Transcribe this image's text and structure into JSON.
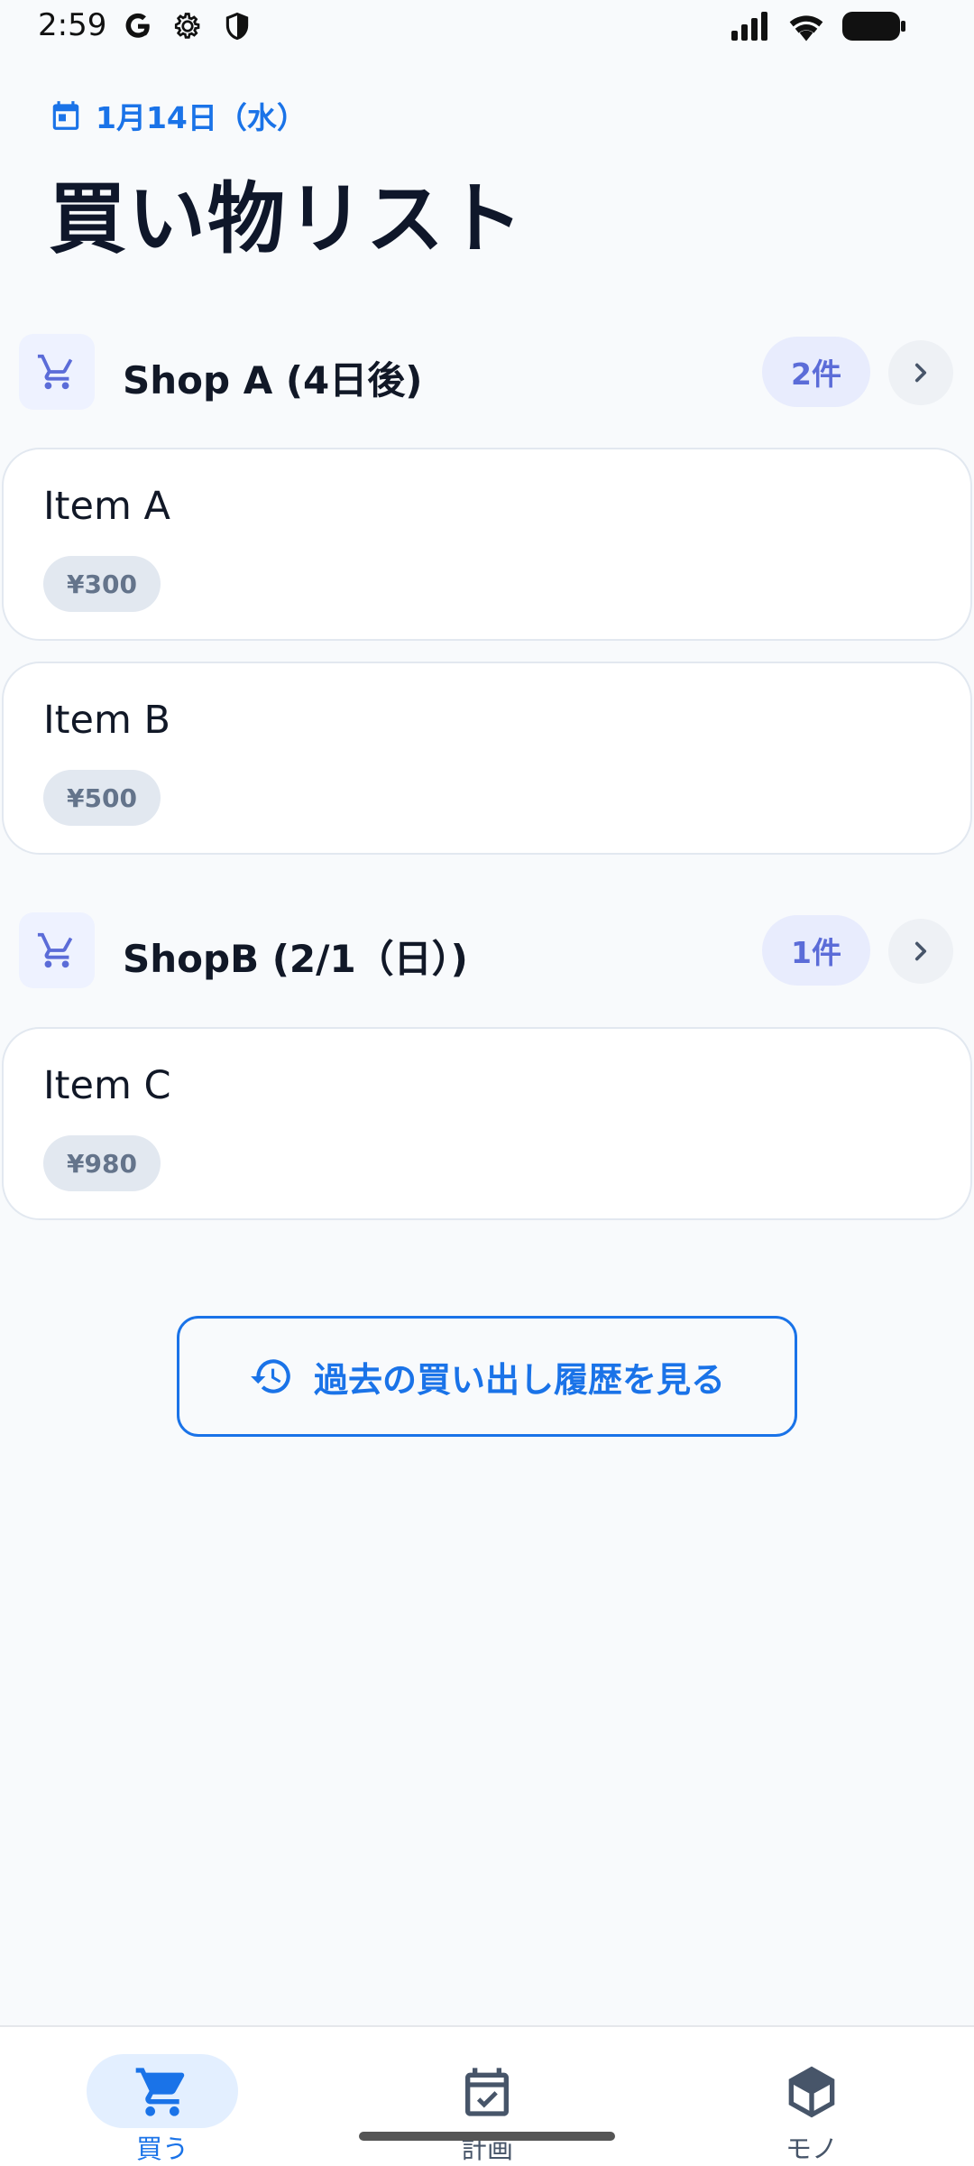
{
  "status_bar": {
    "time": "2:59",
    "left_icons": [
      "google-icon",
      "gear-icon",
      "shield-icon"
    ],
    "right_icons": [
      "signal-icon",
      "wifi-icon",
      "battery-icon"
    ]
  },
  "header": {
    "date": "1月14日（水）",
    "title": "買い物リスト"
  },
  "shops": [
    {
      "name": "Shop A (4日後)",
      "count": "2件",
      "items": [
        {
          "name": "Item A",
          "price": "¥300"
        },
        {
          "name": "Item B",
          "price": "¥500"
        }
      ]
    },
    {
      "name": "ShopB (2/1（日）)",
      "count": "1件",
      "items": [
        {
          "name": "Item C",
          "price": "¥980"
        }
      ]
    }
  ],
  "history_button": {
    "label": "過去の買い出し履歴を見る"
  },
  "bottom_nav": [
    {
      "label": "買う",
      "icon": "cart-icon",
      "active": true
    },
    {
      "label": "計画",
      "icon": "calendar-check-icon",
      "active": false
    },
    {
      "label": "モノ",
      "icon": "box-icon",
      "active": false
    }
  ],
  "colors": {
    "accent": "#1a73e8",
    "shop_accent": "#5b6cd8",
    "background": "#f8fafc"
  }
}
